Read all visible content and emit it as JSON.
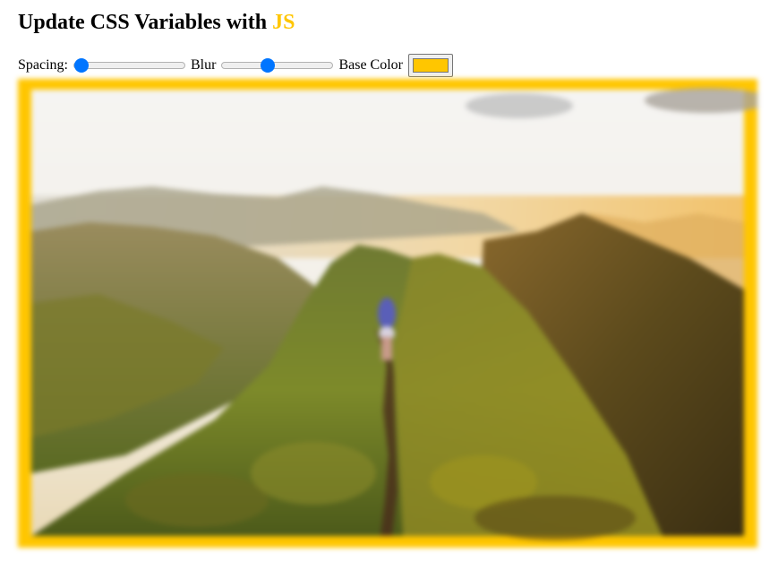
{
  "heading": {
    "prefix": "Update CSS Variables with ",
    "highlight": "JS"
  },
  "controls": {
    "spacing": {
      "label": "Spacing:",
      "value": 10,
      "min": 10,
      "max": 200
    },
    "blur": {
      "label": "Blur",
      "value": 10,
      "min": 0,
      "max": 25
    },
    "base_color": {
      "label": "Base Color",
      "value": "#ffc600"
    }
  },
  "colors": {
    "base": "#ffc600",
    "slider_accent": "#0075ff"
  },
  "image": {
    "subject": "mountain-ridge-hiker-photo"
  }
}
